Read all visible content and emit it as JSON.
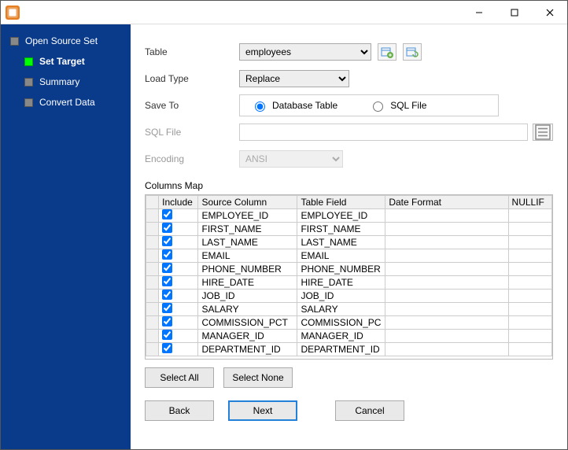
{
  "window": {
    "title": ""
  },
  "sidebar": {
    "items": [
      {
        "label": "Open Source Set",
        "active": false
      },
      {
        "label": "Set Target",
        "active": true
      },
      {
        "label": "Summary",
        "active": false
      },
      {
        "label": "Convert Data",
        "active": false
      }
    ]
  },
  "form": {
    "table_label": "Table",
    "table_value": "employees",
    "load_label": "Load Type",
    "load_value": "Replace",
    "save_label": "Save To",
    "save_opt_db": "Database Table",
    "save_opt_sql": "SQL File",
    "save_selected": "db",
    "sqlfile_label": "SQL File",
    "sqlfile_value": "",
    "encoding_label": "Encoding",
    "encoding_value": "ANSI"
  },
  "columns_title": "Columns Map",
  "grid": {
    "headers": {
      "include": "Include",
      "source": "Source Column",
      "field": "Table Field",
      "date": "Date Format",
      "nullif": "NULLIF"
    },
    "rows": [
      {
        "include": true,
        "source": "EMPLOYEE_ID",
        "field": "EMPLOYEE_ID",
        "date": "",
        "nullif": ""
      },
      {
        "include": true,
        "source": "FIRST_NAME",
        "field": "FIRST_NAME",
        "date": "",
        "nullif": ""
      },
      {
        "include": true,
        "source": "LAST_NAME",
        "field": "LAST_NAME",
        "date": "",
        "nullif": ""
      },
      {
        "include": true,
        "source": "EMAIL",
        "field": "EMAIL",
        "date": "",
        "nullif": ""
      },
      {
        "include": true,
        "source": "PHONE_NUMBER",
        "field": "PHONE_NUMBER",
        "date": "",
        "nullif": ""
      },
      {
        "include": true,
        "source": "HIRE_DATE",
        "field": "HIRE_DATE",
        "date": "",
        "nullif": ""
      },
      {
        "include": true,
        "source": "JOB_ID",
        "field": "JOB_ID",
        "date": "",
        "nullif": ""
      },
      {
        "include": true,
        "source": "SALARY",
        "field": "SALARY",
        "date": "",
        "nullif": ""
      },
      {
        "include": true,
        "source": "COMMISSION_PCT",
        "field": "COMMISSION_PC",
        "date": "",
        "nullif": ""
      },
      {
        "include": true,
        "source": "MANAGER_ID",
        "field": "MANAGER_ID",
        "date": "",
        "nullif": ""
      },
      {
        "include": true,
        "source": "DEPARTMENT_ID",
        "field": "DEPARTMENT_ID",
        "date": "",
        "nullif": ""
      }
    ]
  },
  "buttons": {
    "select_all": "Select All",
    "select_none": "Select None",
    "back": "Back",
    "next": "Next",
    "cancel": "Cancel"
  }
}
